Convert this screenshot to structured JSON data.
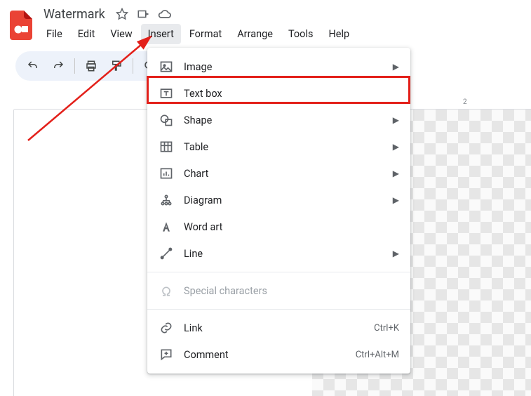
{
  "header": {
    "title": "Watermark",
    "menus": [
      "File",
      "Edit",
      "View",
      "Insert",
      "Format",
      "Arrange",
      "Tools",
      "Help"
    ],
    "active_menu_index": 3
  },
  "ruler": {
    "num2": "2"
  },
  "dropdown": {
    "items": [
      {
        "icon": "image-icon",
        "label": "Image",
        "submenu": true
      },
      {
        "icon": "textbox-icon",
        "label": "Text box"
      },
      {
        "icon": "shape-icon",
        "label": "Shape",
        "submenu": true
      },
      {
        "icon": "table-icon",
        "label": "Table",
        "submenu": true
      },
      {
        "icon": "chart-icon",
        "label": "Chart",
        "submenu": true
      },
      {
        "icon": "diagram-icon",
        "label": "Diagram",
        "submenu": true
      },
      {
        "icon": "wordart-icon",
        "label": "Word art"
      },
      {
        "icon": "line-icon",
        "label": "Line",
        "submenu": true
      },
      {
        "sep": true
      },
      {
        "icon": "omega-icon",
        "label": "Special characters",
        "disabled": true
      },
      {
        "sep": true
      },
      {
        "icon": "link-icon",
        "label": "Link",
        "shortcut": "Ctrl+K"
      },
      {
        "icon": "comment-icon",
        "label": "Comment",
        "shortcut": "Ctrl+Alt+M"
      }
    ]
  }
}
